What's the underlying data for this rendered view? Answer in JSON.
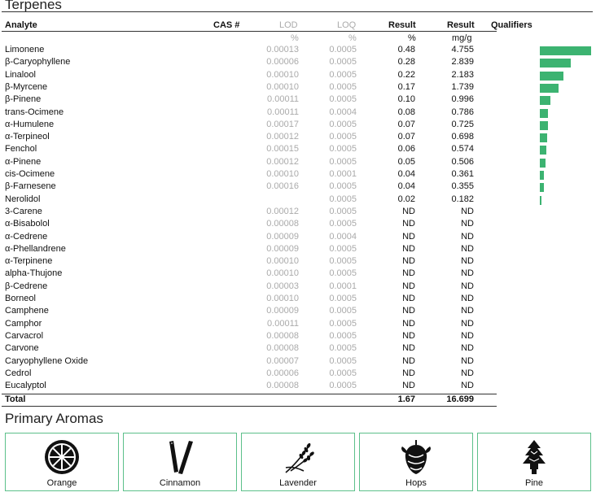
{
  "terpenes_title": "Terpenes",
  "headers": {
    "analyte": "Analyte",
    "cas": "CAS #",
    "lod": "LOD",
    "loq": "LOQ",
    "result_pct": "Result",
    "result_mg": "Result",
    "qualifiers": "Qualifiers"
  },
  "units": {
    "lod": "%",
    "loq": "%",
    "result_pct": "%",
    "result_mg": "mg/g"
  },
  "bar_color": "#3cb371",
  "rows": [
    {
      "name": "Limonene",
      "lod": "0.00013",
      "loq": "0.0005",
      "pct": "0.48",
      "mg": "4.755",
      "bar_fraction": 1.0
    },
    {
      "name": "β-Caryophyllene",
      "lod": "0.00006",
      "loq": "0.0005",
      "pct": "0.28",
      "mg": "2.839",
      "bar_fraction": 0.597
    },
    {
      "name": "Linalool",
      "lod": "0.00010",
      "loq": "0.0005",
      "pct": "0.22",
      "mg": "2.183",
      "bar_fraction": 0.459
    },
    {
      "name": "β-Myrcene",
      "lod": "0.00010",
      "loq": "0.0005",
      "pct": "0.17",
      "mg": "1.739",
      "bar_fraction": 0.366
    },
    {
      "name": "β-Pinene",
      "lod": "0.00011",
      "loq": "0.0005",
      "pct": "0.10",
      "mg": "0.996",
      "bar_fraction": 0.209
    },
    {
      "name": "trans-Ocimene",
      "lod": "0.00011",
      "loq": "0.0004",
      "pct": "0.08",
      "mg": "0.786",
      "bar_fraction": 0.165
    },
    {
      "name": "α-Humulene",
      "lod": "0.00017",
      "loq": "0.0005",
      "pct": "0.07",
      "mg": "0.725",
      "bar_fraction": 0.152
    },
    {
      "name": "α-Terpineol",
      "lod": "0.00012",
      "loq": "0.0005",
      "pct": "0.07",
      "mg": "0.698",
      "bar_fraction": 0.147
    },
    {
      "name": "Fenchol",
      "lod": "0.00015",
      "loq": "0.0005",
      "pct": "0.06",
      "mg": "0.574",
      "bar_fraction": 0.121
    },
    {
      "name": "α-Pinene",
      "lod": "0.00012",
      "loq": "0.0005",
      "pct": "0.05",
      "mg": "0.506",
      "bar_fraction": 0.106
    },
    {
      "name": "cis-Ocimene",
      "lod": "0.00010",
      "loq": "0.0001",
      "pct": "0.04",
      "mg": "0.361",
      "bar_fraction": 0.076
    },
    {
      "name": "β-Farnesene",
      "lod": "0.00016",
      "loq": "0.0005",
      "pct": "0.04",
      "mg": "0.355",
      "bar_fraction": 0.075
    },
    {
      "name": "Nerolidol",
      "lod": "",
      "loq": "0.0005",
      "pct": "0.02",
      "mg": "0.182",
      "bar_fraction": 0.038
    },
    {
      "name": "3-Carene",
      "lod": "0.00012",
      "loq": "0.0005",
      "pct": "ND",
      "mg": "ND",
      "bar_fraction": 0
    },
    {
      "name": "α-Bisabolol",
      "lod": "0.00008",
      "loq": "0.0005",
      "pct": "ND",
      "mg": "ND",
      "bar_fraction": 0
    },
    {
      "name": "α-Cedrene",
      "lod": "0.00009",
      "loq": "0.0004",
      "pct": "ND",
      "mg": "ND",
      "bar_fraction": 0
    },
    {
      "name": "α-Phellandrene",
      "lod": "0.00009",
      "loq": "0.0005",
      "pct": "ND",
      "mg": "ND",
      "bar_fraction": 0
    },
    {
      "name": "α-Terpinene",
      "lod": "0.00010",
      "loq": "0.0005",
      "pct": "ND",
      "mg": "ND",
      "bar_fraction": 0
    },
    {
      "name": "alpha-Thujone",
      "lod": "0.00010",
      "loq": "0.0005",
      "pct": "ND",
      "mg": "ND",
      "bar_fraction": 0
    },
    {
      "name": "β-Cedrene",
      "lod": "0.00003",
      "loq": "0.0001",
      "pct": "ND",
      "mg": "ND",
      "bar_fraction": 0
    },
    {
      "name": "Borneol",
      "lod": "0.00010",
      "loq": "0.0005",
      "pct": "ND",
      "mg": "ND",
      "bar_fraction": 0
    },
    {
      "name": "Camphene",
      "lod": "0.00009",
      "loq": "0.0005",
      "pct": "ND",
      "mg": "ND",
      "bar_fraction": 0
    },
    {
      "name": "Camphor",
      "lod": "0.00011",
      "loq": "0.0005",
      "pct": "ND",
      "mg": "ND",
      "bar_fraction": 0
    },
    {
      "name": "Carvacrol",
      "lod": "0.00008",
      "loq": "0.0005",
      "pct": "ND",
      "mg": "ND",
      "bar_fraction": 0
    },
    {
      "name": "Carvone",
      "lod": "0.00008",
      "loq": "0.0005",
      "pct": "ND",
      "mg": "ND",
      "bar_fraction": 0
    },
    {
      "name": "Caryophyllene Oxide",
      "lod": "0.00007",
      "loq": "0.0005",
      "pct": "ND",
      "mg": "ND",
      "bar_fraction": 0
    },
    {
      "name": "Cedrol",
      "lod": "0.00006",
      "loq": "0.0005",
      "pct": "ND",
      "mg": "ND",
      "bar_fraction": 0
    },
    {
      "name": "Eucalyptol",
      "lod": "0.00008",
      "loq": "0.0005",
      "pct": "ND",
      "mg": "ND",
      "bar_fraction": 0
    }
  ],
  "total": {
    "label": "Total",
    "pct": "1.67",
    "mg": "16.699"
  },
  "aromas_title": "Primary Aromas",
  "aromas": [
    {
      "label": "Orange",
      "icon": "orange-slice-icon"
    },
    {
      "label": "Cinnamon",
      "icon": "cinnamon-sticks-icon"
    },
    {
      "label": "Lavender",
      "icon": "lavender-sprig-icon"
    },
    {
      "label": "Hops",
      "icon": "hops-cone-icon"
    },
    {
      "label": "Pine",
      "icon": "pine-tree-icon"
    }
  ]
}
